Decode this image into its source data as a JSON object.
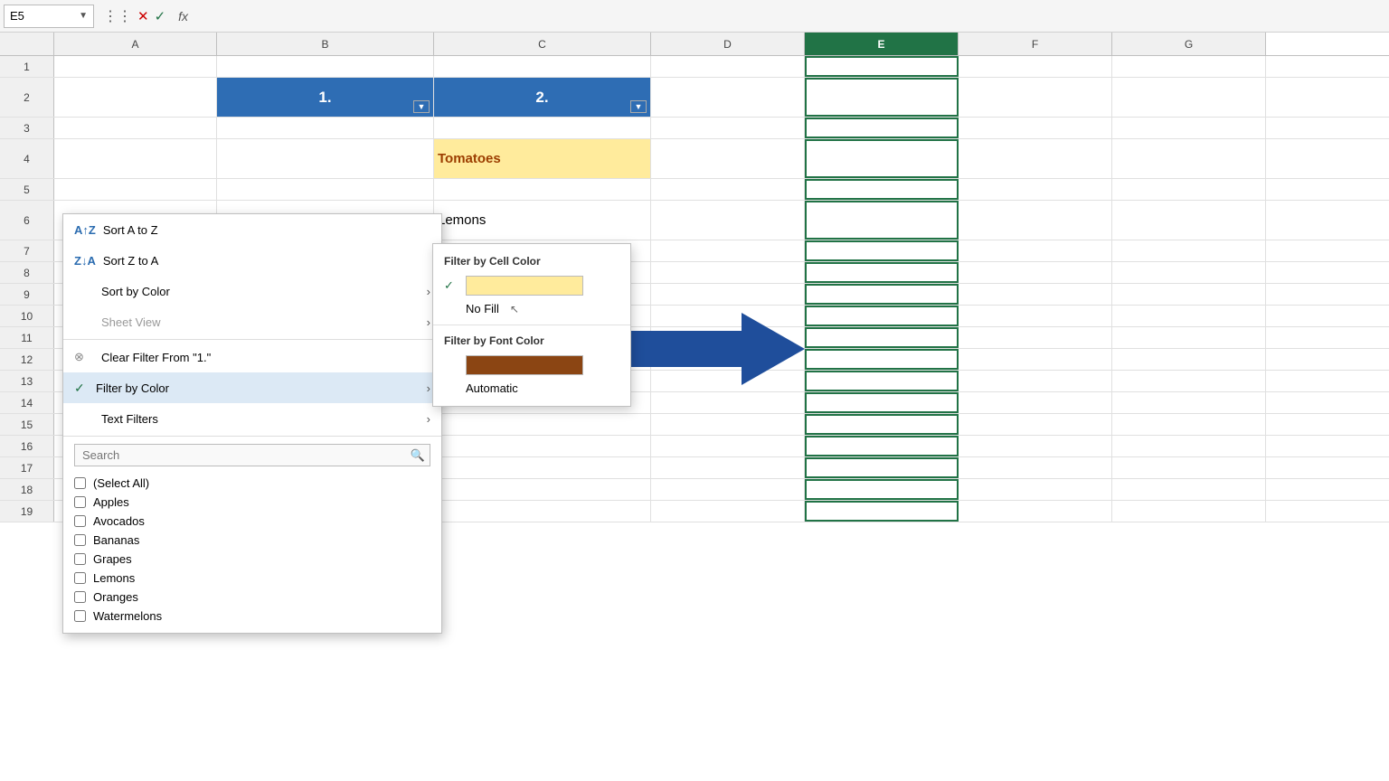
{
  "formulaBar": {
    "cellRef": "E5",
    "cancelIcon": "✕",
    "confirmIcon": "✓",
    "fxLabel": "fx"
  },
  "columns": [
    "A",
    "B",
    "C",
    "D",
    "E",
    "F",
    "G"
  ],
  "rows": [
    {
      "num": 1,
      "cells": [
        "",
        "",
        "",
        "",
        "",
        "",
        ""
      ]
    },
    {
      "num": 2,
      "cells": [
        "",
        "1.",
        "2.",
        "",
        "",
        "",
        ""
      ],
      "style": "header"
    },
    {
      "num": 3,
      "cells": [
        "",
        "",
        "",
        "",
        "",
        "",
        ""
      ]
    },
    {
      "num": 4,
      "cells": [
        "",
        "",
        "Tomatoes",
        "",
        "",
        "",
        ""
      ],
      "style": "tomatoes"
    },
    {
      "num": 5,
      "cells": [
        "",
        "",
        "",
        "",
        "",
        "",
        ""
      ]
    },
    {
      "num": 6,
      "cells": [
        "",
        "",
        "Lemons",
        "",
        "",
        "",
        ""
      ]
    },
    {
      "num": 7,
      "cells": [
        "",
        "",
        "",
        "",
        "",
        "",
        ""
      ]
    },
    {
      "num": 8,
      "cells": [
        "",
        "",
        "",
        "",
        "",
        "",
        ""
      ]
    },
    {
      "num": 9,
      "cells": [
        "",
        "",
        "",
        "",
        "",
        "",
        ""
      ]
    },
    {
      "num": 10,
      "cells": [
        "",
        "",
        "",
        "",
        "",
        "",
        ""
      ]
    },
    {
      "num": 11,
      "cells": [
        "",
        "",
        "",
        "",
        "",
        "",
        ""
      ]
    },
    {
      "num": 12,
      "cells": [
        "",
        "",
        "",
        "",
        "",
        "",
        ""
      ]
    },
    {
      "num": 13,
      "cells": [
        "",
        "",
        "",
        "",
        "",
        "",
        ""
      ]
    },
    {
      "num": 14,
      "cells": [
        "",
        "",
        "",
        "",
        "",
        "",
        ""
      ]
    },
    {
      "num": 15,
      "cells": [
        "",
        "",
        "",
        "",
        "",
        "",
        ""
      ]
    },
    {
      "num": 16,
      "cells": [
        "",
        "",
        "",
        "",
        "",
        "",
        ""
      ]
    },
    {
      "num": 17,
      "cells": [
        "",
        "",
        "",
        "",
        "",
        "",
        ""
      ]
    },
    {
      "num": 18,
      "cells": [
        "",
        "",
        "",
        "",
        "",
        "",
        ""
      ]
    },
    {
      "num": 19,
      "cells": [
        "",
        "",
        "",
        "",
        "",
        "",
        ""
      ]
    }
  ],
  "contextMenu": {
    "items": [
      {
        "id": "sort-az",
        "icon": "AZ↓",
        "label": "Sort A to Z",
        "hasArrow": false,
        "disabled": false
      },
      {
        "id": "sort-za",
        "icon": "ZA↓",
        "label": "Sort Z to A",
        "hasArrow": false,
        "disabled": false
      },
      {
        "id": "sort-color",
        "icon": "",
        "label": "Sort by Color",
        "hasArrow": true,
        "disabled": false
      },
      {
        "id": "sheet-view",
        "icon": "",
        "label": "Sheet View",
        "hasArrow": true,
        "disabled": true
      },
      {
        "id": "clear-filter",
        "icon": "⊗",
        "label": "Clear Filter From \"1.\"",
        "hasArrow": false,
        "disabled": false
      },
      {
        "id": "filter-color",
        "icon": "✓",
        "label": "Filter by Color",
        "hasArrow": true,
        "disabled": false,
        "active": true
      },
      {
        "id": "text-filters",
        "icon": "",
        "label": "Text Filters",
        "hasArrow": true,
        "disabled": false
      }
    ],
    "searchPlaceholder": "Search",
    "checkboxItems": [
      {
        "label": "(Select All)",
        "checked": false
      },
      {
        "label": "Apples",
        "checked": false
      },
      {
        "label": "Avocados",
        "checked": false
      },
      {
        "label": "Bananas",
        "checked": false
      },
      {
        "label": "Grapes",
        "checked": false
      },
      {
        "label": "Lemons",
        "checked": false
      },
      {
        "label": "Oranges",
        "checked": false
      },
      {
        "label": "Watermelons",
        "checked": false
      }
    ]
  },
  "colorSubmenu": {
    "cellColorTitle": "Filter by Cell Color",
    "cellColors": [
      {
        "color": "#FFEB9C",
        "hasCheck": true
      }
    ],
    "noFill": "No Fill",
    "fontColorTitle": "Filter by Font Color",
    "fontColors": [
      {
        "color": "#8B4513",
        "hasCheck": false
      }
    ],
    "automatic": "Automatic"
  },
  "colors": {
    "headerBlue": "#2E6DB4",
    "tomatoText": "#9C3E00",
    "tomatoBg": "#FFEB9C",
    "selectedCol": "#217346",
    "fontColorBrown": "#8B4513"
  }
}
